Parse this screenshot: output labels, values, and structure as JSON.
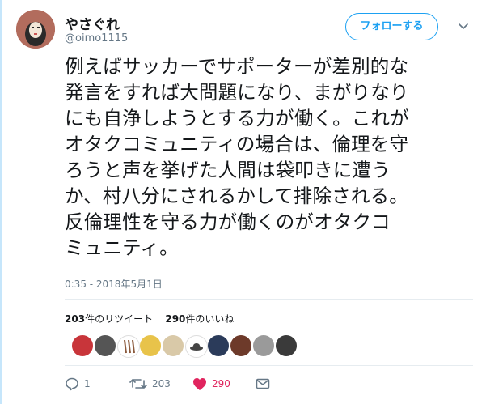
{
  "user": {
    "name": "やさぐれ",
    "handle": "@oimo1115",
    "avatar_icon": "avatar-icon"
  },
  "follow_button": {
    "label": "フォローする"
  },
  "tweet": {
    "lines": [
      "例えばサッカーでサポーターが差別的な",
      "発言をすれば大問題になり、まがりなり",
      "にも自浄しようとする力が働く。これが",
      "オタクコミュニティの場合は、倫理を守",
      "ろうと声を挙げた人間は袋叩きに遭う",
      "か、村八分にされるかして排除される。",
      "反倫理性を守る力が働くのがオタクコ",
      "ミュニティ。"
    ],
    "timestamp": "0:35 - 2018年5月1日"
  },
  "stats": {
    "retweets_count": "203",
    "retweets_label": "件のリツイート",
    "likes_count": "290",
    "likes_label": "件のいいね"
  },
  "actions": {
    "reply_count": "1",
    "retweet_count": "203",
    "like_count": "290"
  },
  "colors": {
    "accent": "#1da1f2",
    "like": "#e0245e",
    "muted": "#657786"
  }
}
